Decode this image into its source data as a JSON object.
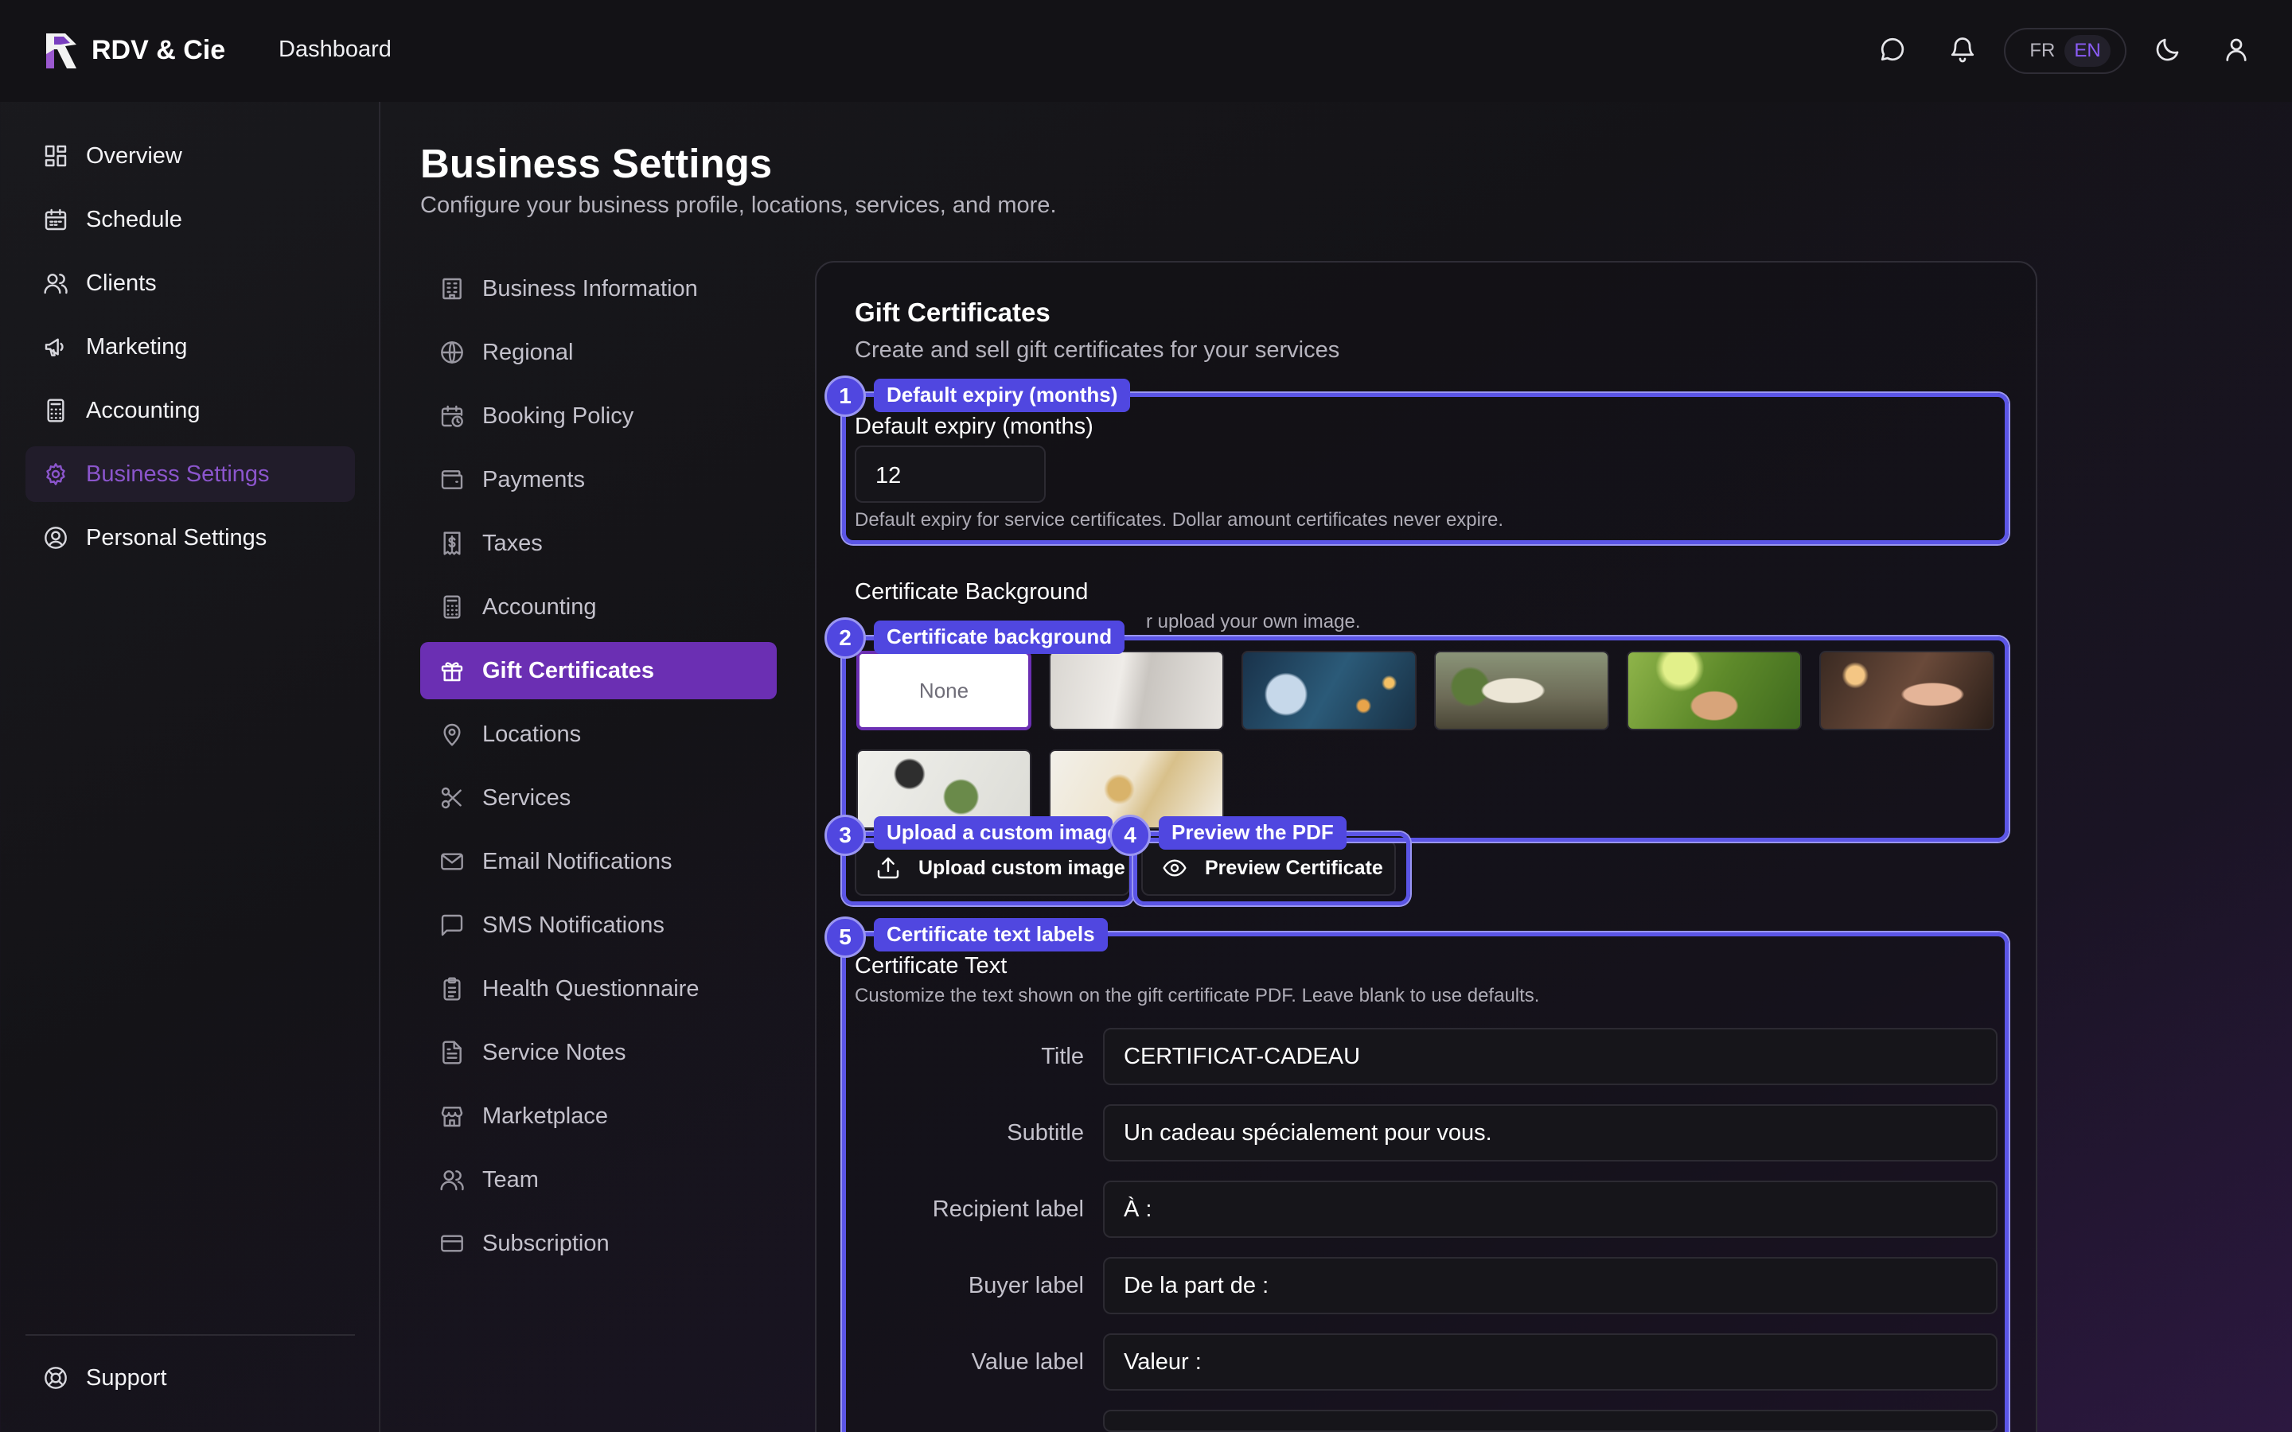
{
  "brand": {
    "name": "RDV & Cie"
  },
  "header": {
    "breadcrumb": "Dashboard",
    "lang": {
      "fr": "FR",
      "en": "EN",
      "active": "EN"
    }
  },
  "sidebar": {
    "items": [
      {
        "label": "Overview",
        "icon": "dashboard-icon"
      },
      {
        "label": "Schedule",
        "icon": "calendar-icon"
      },
      {
        "label": "Clients",
        "icon": "users-icon"
      },
      {
        "label": "Marketing",
        "icon": "megaphone-icon"
      },
      {
        "label": "Accounting",
        "icon": "calculator-icon"
      },
      {
        "label": "Business Settings",
        "icon": "gear-icon",
        "active": true
      },
      {
        "label": "Personal Settings",
        "icon": "user-circle-icon"
      }
    ],
    "support": "Support"
  },
  "page": {
    "title": "Business Settings",
    "subtitle": "Configure your business profile, locations, services, and more."
  },
  "settings_nav": [
    {
      "label": "Business Information",
      "icon": "building-icon"
    },
    {
      "label": "Regional",
      "icon": "globe-icon"
    },
    {
      "label": "Booking Policy",
      "icon": "calendar-clock-icon"
    },
    {
      "label": "Payments",
      "icon": "wallet-icon"
    },
    {
      "label": "Taxes",
      "icon": "receipt-icon"
    },
    {
      "label": "Accounting",
      "icon": "calculator-icon"
    },
    {
      "label": "Gift Certificates",
      "icon": "gift-icon",
      "active": true
    },
    {
      "label": "Locations",
      "icon": "map-pin-icon"
    },
    {
      "label": "Services",
      "icon": "scissors-icon"
    },
    {
      "label": "Email Notifications",
      "icon": "mail-icon"
    },
    {
      "label": "SMS Notifications",
      "icon": "message-square-icon"
    },
    {
      "label": "Health Questionnaire",
      "icon": "clipboard-icon"
    },
    {
      "label": "Service Notes",
      "icon": "file-text-icon"
    },
    {
      "label": "Marketplace",
      "icon": "store-icon"
    },
    {
      "label": "Team",
      "icon": "users-icon"
    },
    {
      "label": "Subscription",
      "icon": "credit-card-icon"
    }
  ],
  "card": {
    "title": "Gift Certificates",
    "subtitle": "Create and sell gift certificates for your services",
    "expiry": {
      "label": "Default expiry (months)",
      "value": "12",
      "help": "Default expiry for service certificates. Dollar amount certificates never expire."
    },
    "background": {
      "label": "Certificate Background",
      "help_visible": "r upload your own image.",
      "none_label": "None",
      "selected": "None"
    },
    "buttons": {
      "upload": "Upload custom image",
      "preview": "Preview Certificate"
    },
    "text": {
      "label": "Certificate Text",
      "help": "Customize the text shown on the gift certificate PDF. Leave blank to use defaults.",
      "fields": [
        {
          "label": "Title",
          "value": "CERTIFICAT-CADEAU"
        },
        {
          "label": "Subtitle",
          "value": "Un cadeau spécialement pour vous."
        },
        {
          "label": "Recipient label",
          "value": "À :"
        },
        {
          "label": "Buyer label",
          "value": "De la part de :"
        },
        {
          "label": "Value label",
          "value": "Valeur :"
        }
      ]
    }
  },
  "annotations": [
    {
      "num": "1",
      "label": "Default expiry (months)"
    },
    {
      "num": "2",
      "label": "Certificate background"
    },
    {
      "num": "3",
      "label": "Upload a custom image"
    },
    {
      "num": "4",
      "label": "Preview the PDF"
    },
    {
      "num": "5",
      "label": "Certificate text labels"
    }
  ],
  "colors": {
    "accent": "#6b2fb3",
    "accent_text": "#8b55cc",
    "annotation": "#5047e0",
    "background": "#141317"
  }
}
